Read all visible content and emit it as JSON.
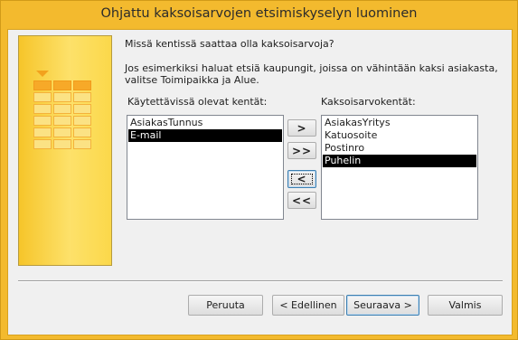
{
  "window": {
    "title": "Ohjattu kaksoisarvojen etsimiskyselyn luominen"
  },
  "prompt": {
    "question": "Missä kentissä saattaa olla kaksoisarvoja?",
    "hint_line1": "Jos esimerkiksi haluat etsiä kaupungit, joissa on vähintään kaksi asiakasta,",
    "hint_line2": "valitse Toimipaikka ja Alue."
  },
  "available": {
    "label": "Käytettävissä olevat kentät:",
    "items": [
      "AsiakasTunnus",
      "E-mail"
    ],
    "selected_index": 1
  },
  "duplicates": {
    "label": "Kaksoisarvokentät:",
    "items": [
      "AsiakasYritys",
      "Katuosoite",
      "Postinro",
      "Puhelin"
    ],
    "selected_index": 3
  },
  "move_buttons": {
    "add_one": ">",
    "add_all": ">>",
    "remove_one": "<",
    "remove_all": "<<"
  },
  "footer": {
    "cancel": "Peruuta",
    "back": "< Edellinen",
    "next": "Seuraava >",
    "finish": "Valmis"
  }
}
